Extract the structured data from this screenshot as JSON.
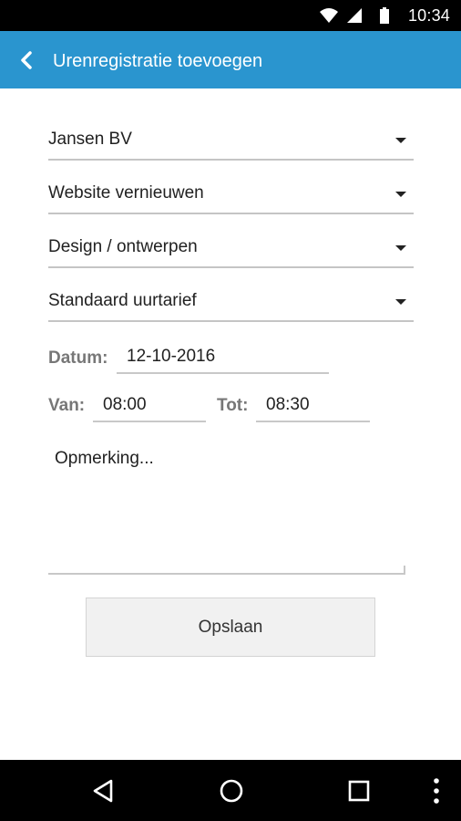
{
  "status_bar": {
    "time": "10:34",
    "icons": [
      "wifi-icon",
      "cell-signal-icon",
      "battery-icon"
    ]
  },
  "app_bar": {
    "title": "Urenregistratie toevoegen",
    "back_icon": "chevron-left-icon",
    "color": "#2a95cf"
  },
  "form": {
    "client": "Jansen BV",
    "project": "Website vernieuwen",
    "activity": "Design / ontwerpen",
    "rate": "Standaard uurtarief",
    "date_label": "Datum:",
    "date_value": "12-10-2016",
    "from_label": "Van:",
    "from_value": "08:00",
    "to_label": "Tot:",
    "to_value": "08:30",
    "remark_placeholder": "Opmerking...",
    "save_label": "Opslaan"
  },
  "nav_bar": {
    "icons": [
      "back-triangle-icon",
      "home-circle-icon",
      "recents-square-icon",
      "overflow-dots-icon"
    ]
  }
}
